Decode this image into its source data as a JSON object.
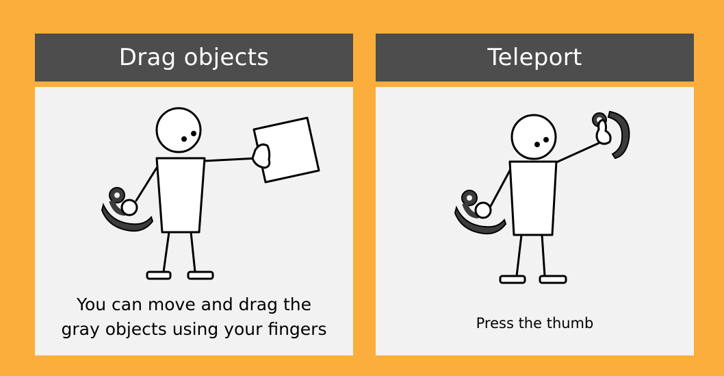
{
  "colors": {
    "background": "#FBAE3C",
    "header": "#4D4D4D",
    "card": "#F2F2F2",
    "stroke": "#000000",
    "controller": "#3C3C3C"
  },
  "panels": [
    {
      "title": "Drag objects",
      "caption_lines": [
        "You can move and drag the",
        "gray objects using your fingers"
      ]
    },
    {
      "title": "Teleport",
      "caption_lines": [
        "Press the thumb"
      ]
    }
  ]
}
